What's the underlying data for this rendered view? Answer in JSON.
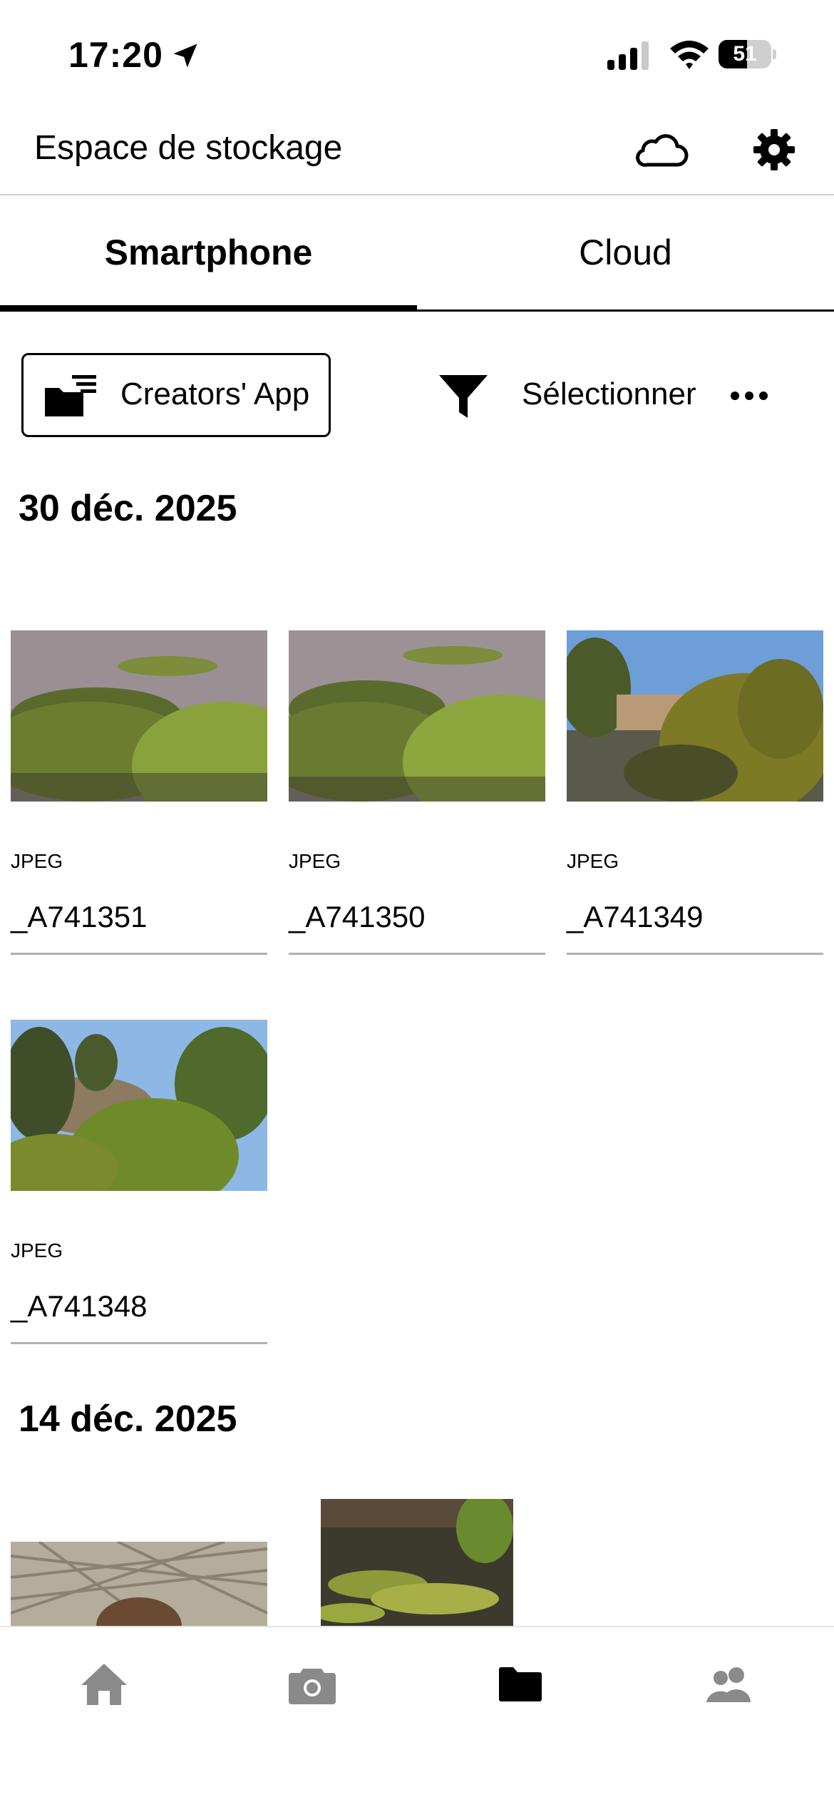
{
  "status_bar": {
    "time": "17:20",
    "battery": "51"
  },
  "header": {
    "title": "Espace de stockage"
  },
  "tabs": [
    {
      "label": "Smartphone",
      "active": true
    },
    {
      "label": "Cloud",
      "active": false
    }
  ],
  "toolbar": {
    "folder_label": "Creators' App",
    "select_label": "Sélectionner"
  },
  "sections": [
    {
      "date": "30 déc. 2025",
      "items": [
        {
          "type": "JPEG",
          "name": "_A741351"
        },
        {
          "type": "JPEG",
          "name": "_A741350"
        },
        {
          "type": "JPEG",
          "name": "_A741349"
        },
        {
          "type": "JPEG",
          "name": "_A741348"
        }
      ]
    },
    {
      "date": "14 déc. 2025",
      "items": []
    }
  ],
  "bottom_nav": [
    {
      "icon": "home-icon",
      "active": false
    },
    {
      "icon": "camera-icon",
      "active": false
    },
    {
      "icon": "folder-icon",
      "active": true
    },
    {
      "icon": "people-icon",
      "active": false
    }
  ],
  "colors": {
    "active": "#000000",
    "inactive": "#8a8a8a",
    "divider": "#b0b0b0"
  }
}
